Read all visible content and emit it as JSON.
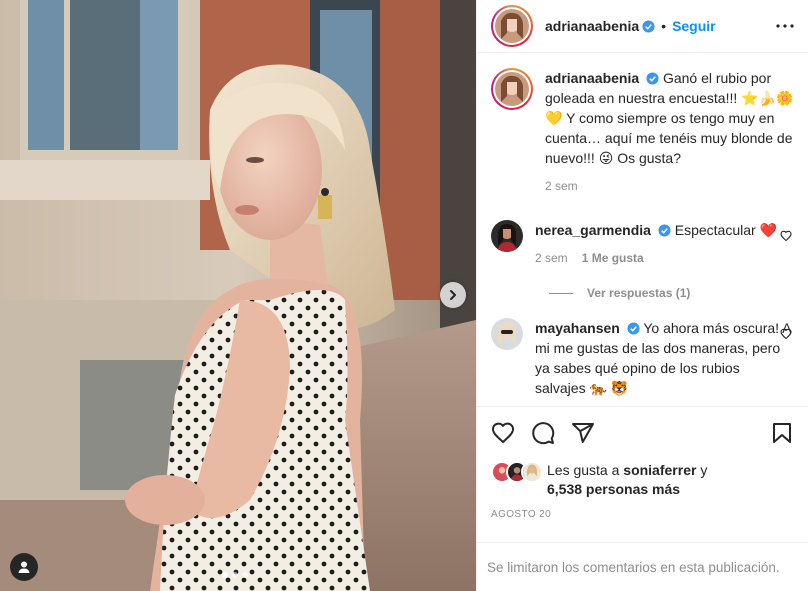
{
  "post": {
    "author": "adrianaabenia",
    "follow_label": "Seguir",
    "dot": "•",
    "caption_user": "adrianaabenia",
    "caption": "Ganó el rubio por goleada en nuestra encuesta!!! ⭐️🍌🌼💛 Y como siempre os tengo muy en cuenta… aquí me tenéis muy blonde de nuevo!!! 😜 Os gusta?",
    "caption_time": "2 sem"
  },
  "comments": [
    {
      "user": "nerea_garmendia",
      "text": "Espectacular ❤️",
      "time": "2 sem",
      "likes": "1 Me gusta",
      "replies": "Ver respuestas (1)"
    },
    {
      "user": "mayahansen",
      "text": "Yo ahora más oscura! A mi me gustas de las dos maneras, pero ya sabes qué opino de los rubios salvajes 🐅 🐯"
    }
  ],
  "likes": {
    "prefix": "Les gusta a",
    "user": "soniaferrer",
    "conj": "y",
    "count": "6,538 personas más"
  },
  "date": "AGOSTO 20",
  "footer_text": "Se limitaron los comentarios en esta publicación.",
  "carousel": {
    "slides": 3,
    "active": 1
  },
  "colors": {
    "accent": "#0095f6",
    "verified": "#3897f0",
    "muted": "#8e8e8e"
  },
  "icons": [
    "more-icon",
    "heart-icon",
    "comment-icon",
    "share-icon",
    "save-icon",
    "chevron-right-icon",
    "user-tag-icon",
    "verified-icon"
  ]
}
